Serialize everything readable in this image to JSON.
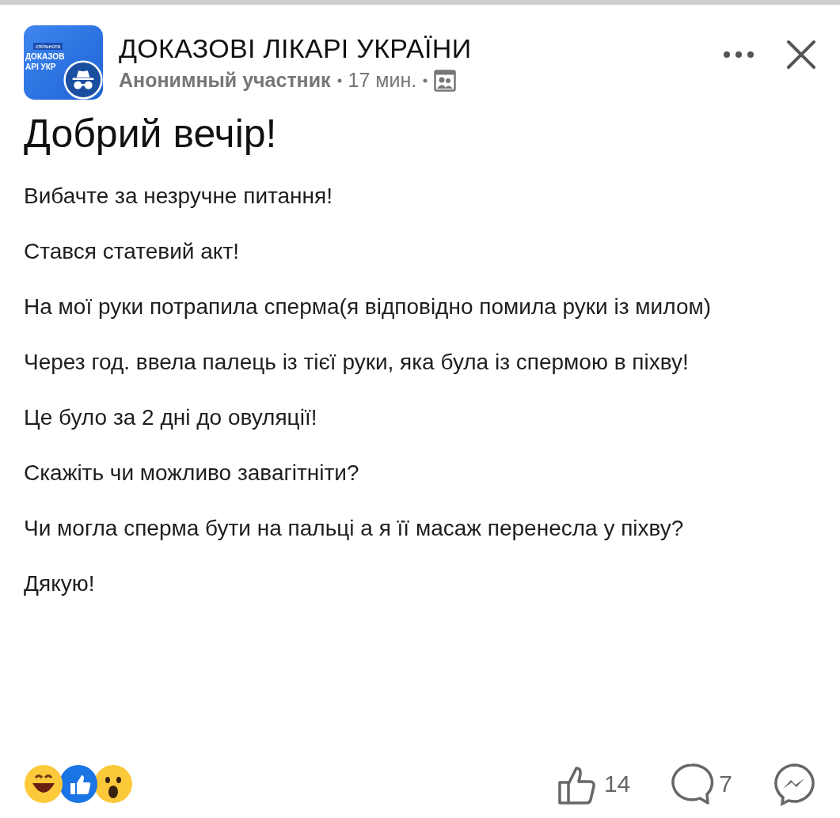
{
  "group": {
    "name": "ДОКАЗОВІ ЛІКАРІ УКРАЇНИ",
    "avatar": {
      "tag": "спільнота",
      "lines": [
        "ДОКАЗОВ",
        "АРІ УКР"
      ]
    },
    "author": "Анонимный участник",
    "time": "17 мин."
  },
  "title": "Добрий вечір!",
  "paragraphs": [
    "Вибачте за незручне питання!",
    "Стався статевий акт!",
    "На мої руки потрапила сперма(я відповідно помила руки із милом)",
    "Через год. ввела палець із тієї руки, яка була із спермою в піхву!",
    "Це було за 2 дні до овуляції!",
    "Скажіть чи можливо завагітніти?",
    "Чи могла сперма бути на пальці а я її масаж перенесла у піхву?",
    "Дякую!"
  ],
  "reactions": [
    {
      "kind": "haha"
    },
    {
      "kind": "like"
    },
    {
      "kind": "wow"
    }
  ],
  "likes": "14",
  "comments": "7"
}
